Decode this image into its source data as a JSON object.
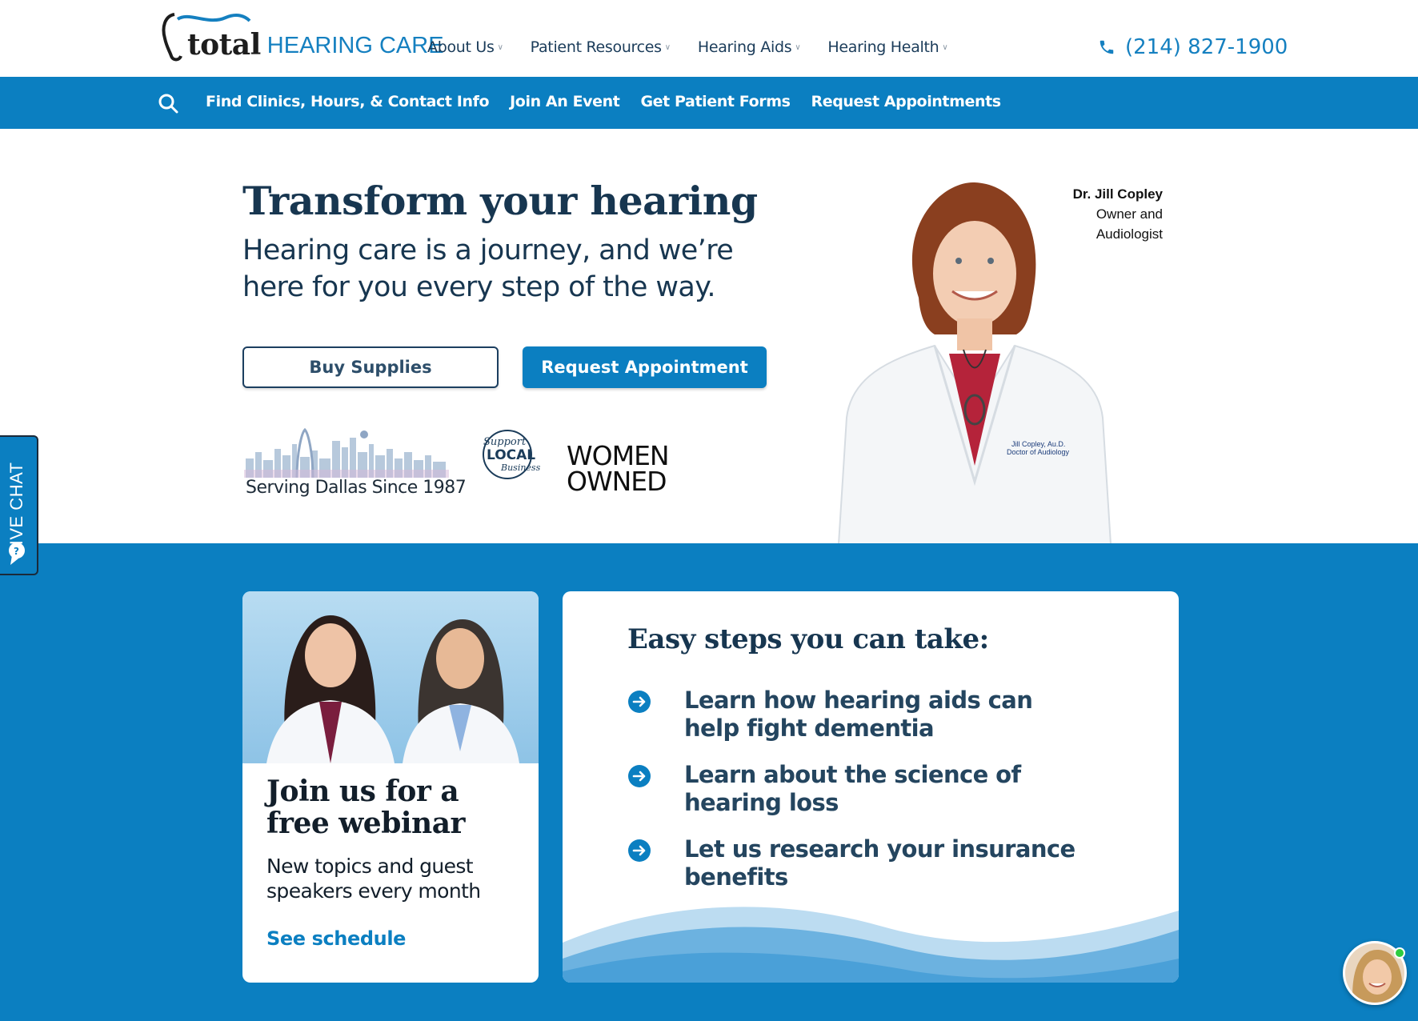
{
  "header": {
    "logo_total": "total",
    "logo_hearing_care": "HEARING CARE",
    "nav": [
      {
        "label": "About Us"
      },
      {
        "label": "Patient Resources"
      },
      {
        "label": "Hearing Aids"
      },
      {
        "label": "Hearing Health"
      }
    ],
    "phone": "(214) 827-1900"
  },
  "subnav": {
    "links": [
      {
        "label": "Find Clinics, Hours, & Contact Info"
      },
      {
        "label": "Join An Event"
      },
      {
        "label": "Get Patient Forms"
      },
      {
        "label": "Request Appointments"
      }
    ]
  },
  "hero": {
    "title": "Transform your hearing",
    "subtitle": "Hearing care is a journey, and we’re here for you every step of the way.",
    "buy_supplies": "Buy Supplies",
    "request_appointment": "Request Appointment",
    "badge_dallas": "Serving Dallas Since 1987",
    "badge_local": "Support LOCAL Business",
    "badge_women_line1": "WOMEN",
    "badge_women_line2": "OWNED",
    "doctor_name": "Dr. Jill Copley",
    "doctor_role_line1": "Owner and",
    "doctor_role_line2": "Audiologist"
  },
  "webinar": {
    "title": "Join us for a free webinar",
    "text": "New topics and guest speakers every month",
    "link": "See schedule"
  },
  "steps": {
    "title": "Easy steps you can take:",
    "items": [
      {
        "text": "Learn how hearing aids can help fight dementia"
      },
      {
        "text": "Learn about the science of hearing loss"
      },
      {
        "text": "Let us research your insurance benefits"
      }
    ]
  },
  "live_chat": "LIVE CHAT",
  "colors": {
    "primary_blue": "#0b7fc1",
    "navy": "#173650",
    "white": "#ffffff"
  },
  "icons": [
    "ear-logo-icon",
    "chevron-down-icon",
    "phone-icon",
    "search-icon",
    "arrow-right-circle-icon",
    "chat-bubble-icon"
  ]
}
